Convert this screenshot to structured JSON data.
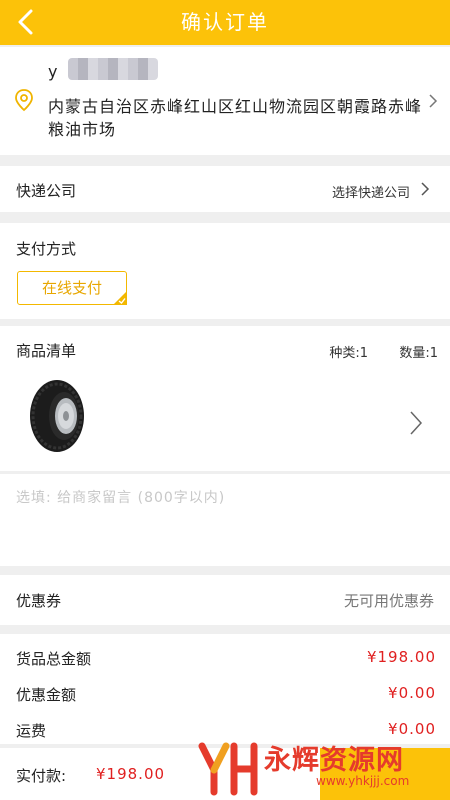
{
  "header": {
    "title": "确认订单"
  },
  "address": {
    "name": "y",
    "text": "内蒙古自治区赤峰红山区红山物流园区朝霞路赤峰粮油市场"
  },
  "courier": {
    "label": "快递公司",
    "value": "选择快递公司"
  },
  "payment": {
    "label": "支付方式",
    "option": "在线支付"
  },
  "goods": {
    "label": "商品清单",
    "types": "种类:1",
    "quantity": "数量:1"
  },
  "note": {
    "placeholder": "选填: 给商家留言 (800字以内)"
  },
  "coupon": {
    "label": "优惠券",
    "value": "无可用优惠券"
  },
  "totals": {
    "goods_total_label": "货品总金额",
    "goods_total": "¥198.00",
    "discount_label": "优惠金额",
    "discount": "¥0.00",
    "shipping_label": "运费",
    "shipping": "¥0.00"
  },
  "footer": {
    "pay_label": "实付款:",
    "pay_amount": "¥198.00"
  },
  "watermark": {
    "text": "永辉资源网",
    "url": "www.yhkjjj.com"
  },
  "colors": {
    "accent": "#fcc209",
    "price": "#e02020"
  }
}
